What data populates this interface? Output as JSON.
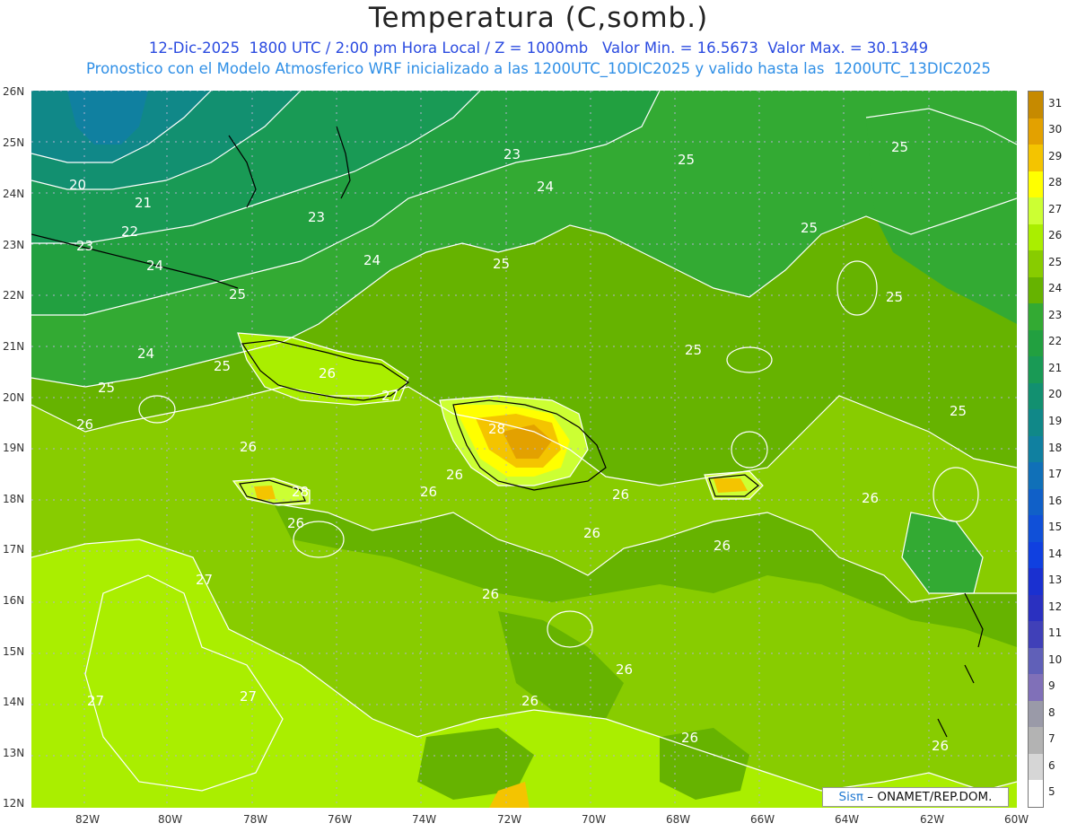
{
  "title": "Temperatura (C,somb.)",
  "subtitle_line1": "12-Dic-2025  1800 UTC / 2:00 pm Hora Local / Z = 1000mb   Valor Min. = 16.5673  Valor Max. = 30.1349",
  "subtitle_line2": "Pronostico con el Modelo Atmosferico WRF inicializado a las 1200UTC_10DIC2025 y valido hasta las  1200UTC_13DIC2025",
  "lat_labels": [
    "26N",
    "25N",
    "24N",
    "23N",
    "22N",
    "21N",
    "20N",
    "19N",
    "18N",
    "17N",
    "16N",
    "15N",
    "14N",
    "13N",
    "12N"
  ],
  "lon_labels": [
    "82W",
    "80W",
    "78W",
    "76W",
    "74W",
    "72W",
    "70W",
    "68W",
    "66W",
    "64W",
    "62W",
    "60W"
  ],
  "colorbar": {
    "labels": [
      "31",
      "30",
      "29",
      "28",
      "27",
      "26",
      "25",
      "24",
      "23",
      "22",
      "21",
      "20",
      "19",
      "18",
      "17",
      "16",
      "15",
      "14",
      "13",
      "12",
      "11",
      "10",
      "9",
      "8",
      "7",
      "6",
      "5"
    ],
    "colors": [
      "#c68a00",
      "#e3a100",
      "#f4c400",
      "#ffff00",
      "#ccff33",
      "#aaee00",
      "#88cc00",
      "#66b300",
      "#33aa33",
      "#22a040",
      "#199a55",
      "#129070",
      "#108888",
      "#1080a0",
      "#1070b8",
      "#1060c8",
      "#1050d8",
      "#1040e0",
      "#1a30d0",
      "#2a30c0",
      "#4040b8",
      "#6060b8",
      "#8070b8",
      "#9a9aa8",
      "#b3b3b3",
      "#d6d6d6",
      "#ffffff"
    ]
  },
  "contour_labels": [
    "20",
    "21",
    "22",
    "23",
    "23",
    "23",
    "24",
    "24",
    "24",
    "24",
    "25",
    "25",
    "25",
    "25",
    "25",
    "25",
    "25",
    "25",
    "25",
    "25",
    "26",
    "26",
    "26",
    "26",
    "26",
    "26",
    "26",
    "26",
    "26",
    "26",
    "26",
    "26",
    "26",
    "26",
    "26",
    "27",
    "27",
    "27",
    "27",
    "28",
    "28"
  ],
  "credit": {
    "logo": "Sis",
    "pi": "π",
    "text": "– ONAMET/REP.DOM."
  }
}
